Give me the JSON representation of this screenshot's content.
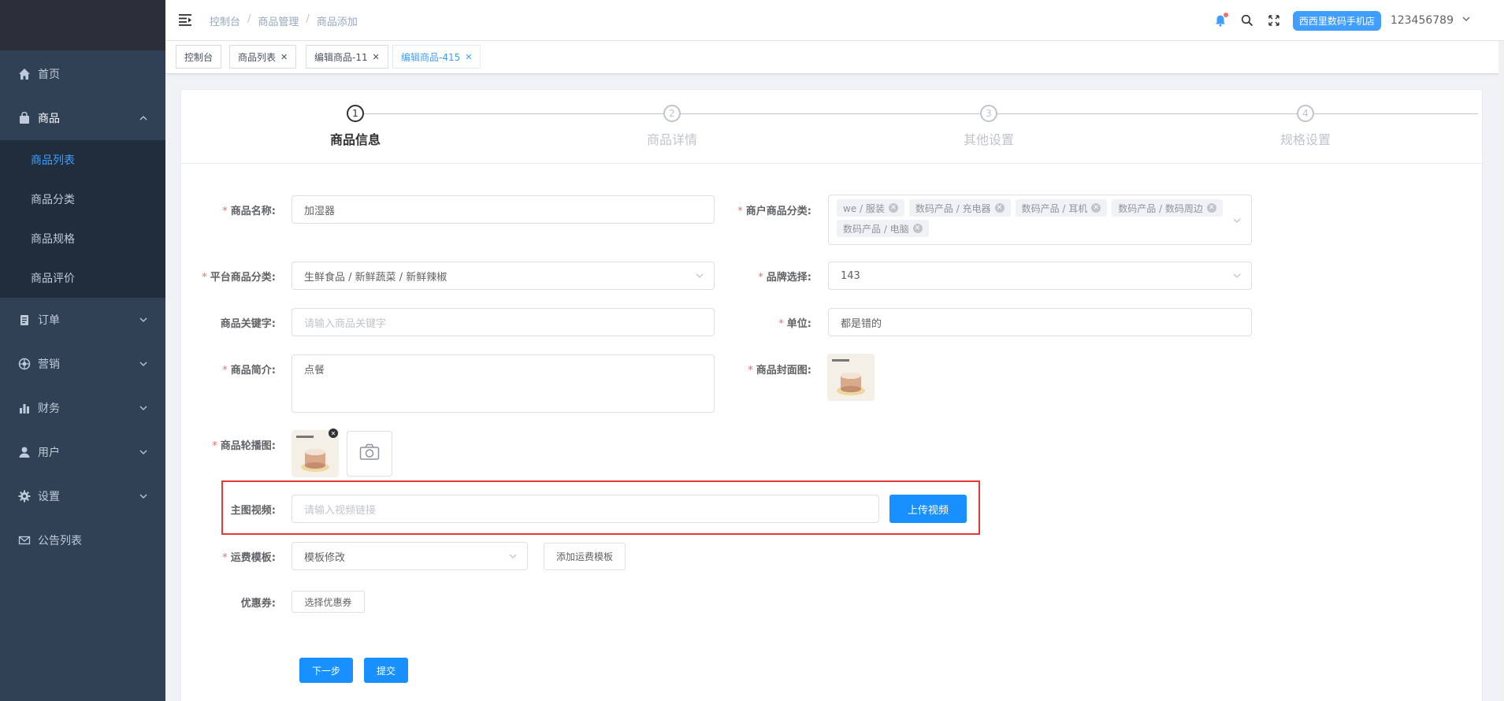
{
  "sidebar": {
    "items": [
      {
        "label": "首页",
        "icon": "home-icon"
      },
      {
        "label": "商品",
        "icon": "bag-icon"
      },
      {
        "label": "订单",
        "icon": "clipboard-icon"
      },
      {
        "label": "营销",
        "icon": "aperture-icon"
      },
      {
        "label": "财务",
        "icon": "bar-chart-icon"
      },
      {
        "label": "用户",
        "icon": "user-icon"
      },
      {
        "label": "设置",
        "icon": "gear-icon"
      },
      {
        "label": "公告列表",
        "icon": "mail-icon"
      }
    ],
    "sub_items": [
      "商品列表",
      "商品分类",
      "商品规格",
      "商品评价"
    ]
  },
  "header": {
    "breadcrumb": [
      "控制台",
      "商品管理",
      "商品添加"
    ],
    "store_name": "西西里数码手机店",
    "username": "123456789"
  },
  "tags": [
    {
      "label": "控制台"
    },
    {
      "label": "商品列表"
    },
    {
      "label": "编辑商品-11"
    },
    {
      "label": "编辑商品-415"
    }
  ],
  "steps": [
    {
      "num": "1",
      "title": "商品信息"
    },
    {
      "num": "2",
      "title": "商品详情"
    },
    {
      "num": "3",
      "title": "其他设置"
    },
    {
      "num": "4",
      "title": "规格设置"
    }
  ],
  "form": {
    "name_label": "商品名称:",
    "name_value": "加湿器",
    "merchant_cat_label": "商户商品分类:",
    "merchant_cats": [
      "we / 服装",
      "数码产品 / 充电器",
      "数码产品 / 耳机",
      "数码产品 / 数码周边",
      "数码产品 / 电脑"
    ],
    "platform_cat_label": "平台商品分类:",
    "platform_cat_value": "生鲜食品 / 新鲜蔬菜 / 新鲜辣椒",
    "brand_label": "品牌选择:",
    "brand_value": "143",
    "keyword_label": "商品关键字:",
    "keyword_placeholder": "请输入商品关键字",
    "unit_label": "单位:",
    "unit_value": "都是错的",
    "intro_label": "商品简介:",
    "intro_value": "点餐",
    "cover_label": "商品封面图:",
    "carousel_label": "商品轮播图:",
    "video_label": "主图视频:",
    "video_placeholder": "请输入视频链接",
    "upload_video_btn": "上传视频",
    "shipping_label": "运费模板:",
    "shipping_value": "模板修改",
    "add_shipping_btn": "添加运费模板",
    "coupon_label": "优惠券:",
    "coupon_btn": "选择优惠券",
    "next_btn": "下一步",
    "submit_btn": "提交"
  },
  "colors": {
    "primary": "#1890ff",
    "sidebar": "#304156",
    "highlight": "#e53935",
    "required": "#f56c6c"
  }
}
